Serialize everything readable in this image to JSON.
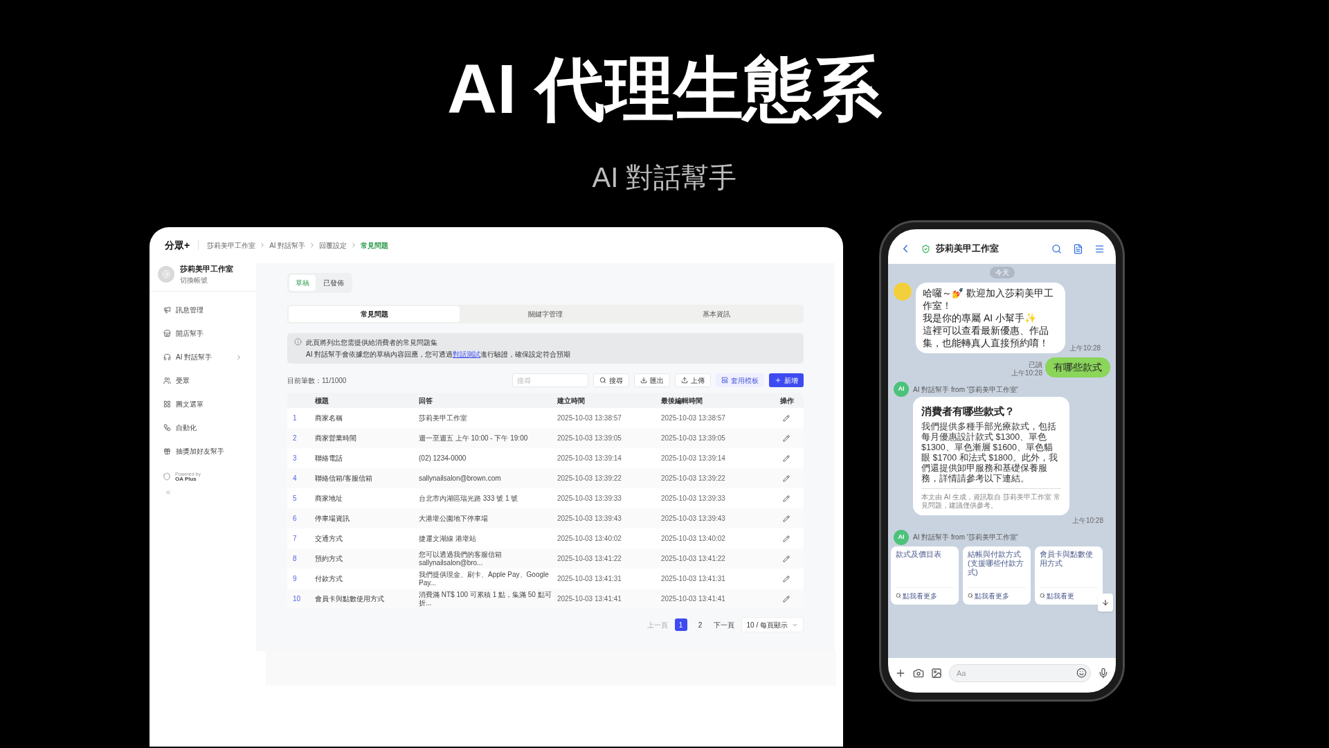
{
  "headline": {
    "title": "AI 代理生態系",
    "subtitle": "AI 對話幫手"
  },
  "dashboard": {
    "brand": "分眾+",
    "breadcrumbs": [
      {
        "label": "莎莉美甲工作室",
        "current": false
      },
      {
        "label": "AI 對話幫手",
        "current": false
      },
      {
        "label": "回覆設定",
        "current": false
      },
      {
        "label": "常見問題",
        "current": true
      }
    ],
    "account": {
      "name": "莎莉美甲工作室",
      "action": "切換帳號"
    },
    "sidebar": [
      {
        "label": "訊息管理",
        "kind": "megaphone",
        "has_submenu": false
      },
      {
        "label": "開店幫手",
        "kind": "store",
        "has_submenu": false
      },
      {
        "label": "AI 對話幫手",
        "kind": "headset",
        "has_submenu": true
      },
      {
        "label": "受眾",
        "kind": "users",
        "has_submenu": false
      },
      {
        "label": "圖文選單",
        "kind": "grid",
        "has_submenu": false
      },
      {
        "label": "自動化",
        "kind": "flow",
        "has_submenu": false
      },
      {
        "label": "抽獎加好友幫手",
        "kind": "gift",
        "has_submenu": false
      }
    ],
    "powered": {
      "label": "Powered by",
      "name": "OA Plus"
    },
    "status_tabs": [
      {
        "label": "草稿",
        "selected": true
      },
      {
        "label": "已發佈",
        "selected": false
      }
    ],
    "section_tabs": [
      {
        "label": "常見問題",
        "selected": true
      },
      {
        "label": "關鍵字管理",
        "selected": false
      },
      {
        "label": "基本資訊",
        "selected": false
      }
    ],
    "notice": {
      "line1": "此頁將列出您需提供給消費者的常見問題集",
      "line2_before": "AI 對話幫手會依據您的草稿內容回應，您可透過",
      "link": "對話測試",
      "line2_after": "進行驗證，確保設定符合預期"
    },
    "count": "目前筆數：11/1000",
    "search": {
      "placeholder": "搜尋"
    },
    "toolbar_buttons": [
      {
        "label": "搜尋",
        "kind": "search"
      },
      {
        "label": "匯出",
        "kind": "export"
      },
      {
        "label": "上傳",
        "kind": "upload"
      },
      {
        "label": "套用模板",
        "kind": "template"
      },
      {
        "label": "新增",
        "kind": "add"
      }
    ],
    "table": {
      "columns": [
        "",
        "標題",
        "回答",
        "建立時間",
        "最後編輯時間",
        "操作"
      ],
      "rows": [
        [
          "1",
          "商家名稱",
          "莎莉美甲工作室",
          "2025-10-03 13:38:57",
          "2025-10-03 13:38:57"
        ],
        [
          "2",
          "商家營業時間",
          "週一至週五 上午 10:00 - 下午 19:00",
          "2025-10-03 13:39:05",
          "2025-10-03 13:39:05"
        ],
        [
          "3",
          "聯絡電話",
          "(02) 1234-0000",
          "2025-10-03 13:39:14",
          "2025-10-03 13:39:14"
        ],
        [
          "4",
          "聯絡信箱/客服信箱",
          "sallynailsalon@brown.com",
          "2025-10-03 13:39:22",
          "2025-10-03 13:39:22"
        ],
        [
          "5",
          "商家地址",
          "台北市內湖區瑞光路 333 號 1 號",
          "2025-10-03 13:39:33",
          "2025-10-03 13:39:33"
        ],
        [
          "6",
          "停車場資訊",
          "大港墘公園地下停車場",
          "2025-10-03 13:39:43",
          "2025-10-03 13:39:43"
        ],
        [
          "7",
          "交通方式",
          "捷運文湖線 港墘站",
          "2025-10-03 13:40:02",
          "2025-10-03 13:40:02"
        ],
        [
          "8",
          "預約方式",
          "您可以透過我們的客服信箱 sallynailsalon@bro...",
          "2025-10-03 13:41:22",
          "2025-10-03 13:41:22"
        ],
        [
          "9",
          "付款方式",
          "我們提供現金、刷卡、Apple Pay、Google Pay...",
          "2025-10-03 13:41:31",
          "2025-10-03 13:41:31"
        ],
        [
          "10",
          "會員卡與點數使用方式",
          "消費滿 NT$ 100 可累積 1 點，集滿 50 點可折...",
          "2025-10-03 13:41:41",
          "2025-10-03 13:41:41"
        ]
      ]
    },
    "pagination": {
      "prev": "上一頁",
      "pages": [
        {
          "label": "1",
          "selected": true
        },
        {
          "label": "2",
          "selected": false
        }
      ],
      "next": "下一頁",
      "page_size": "10 / 每頁顯示"
    }
  },
  "phone": {
    "title": "莎莉美甲工作室",
    "date": "今天",
    "messages": [
      {
        "kind": "incoming",
        "lines": [
          "哈囉～💅 歡迎加入莎莉美甲工作室！",
          "我是你的專屬 AI 小幫手✨",
          "這裡可以查看最新優惠、作品集，也能轉真人直接預約唷！"
        ],
        "time": "上午10:28"
      },
      {
        "kind": "outgoing",
        "text": "有哪些款式",
        "read": "已讀",
        "time": "上午10:28"
      },
      {
        "kind": "ai_card",
        "avatar": "AI",
        "sender": "AI 對話幫手 from '莎莉美甲工作室'",
        "title": "消費者有哪些款式？",
        "body": "我們提供多種手部光療款式，包括每月優惠設計款式 $1300、單色 $1300、單色漸層 $1600、單色貓眼 $1700 和法式 $1800。此外，我們還提供卸甲服務和基礎保養服務，詳情請參考以下連結。",
        "note": "本文由 AI 生成，資訊取自 莎莉美甲工作室 常見問題，建議僅供參考。",
        "time": "上午10:28"
      },
      {
        "kind": "carousel",
        "avatar": "AI",
        "sender": "AI 對話幫手 from '莎莉美甲工作室'",
        "cards": [
          {
            "title": "款式及價目表",
            "action": "點我看更多"
          },
          {
            "title": "結帳與付款方式 (支援哪些付款方式)",
            "action": "點我看更多"
          },
          {
            "title": "會員卡與點數使用方式",
            "action": "點我看更"
          }
        ]
      }
    ],
    "input": {
      "placeholder": "Aa"
    }
  }
}
